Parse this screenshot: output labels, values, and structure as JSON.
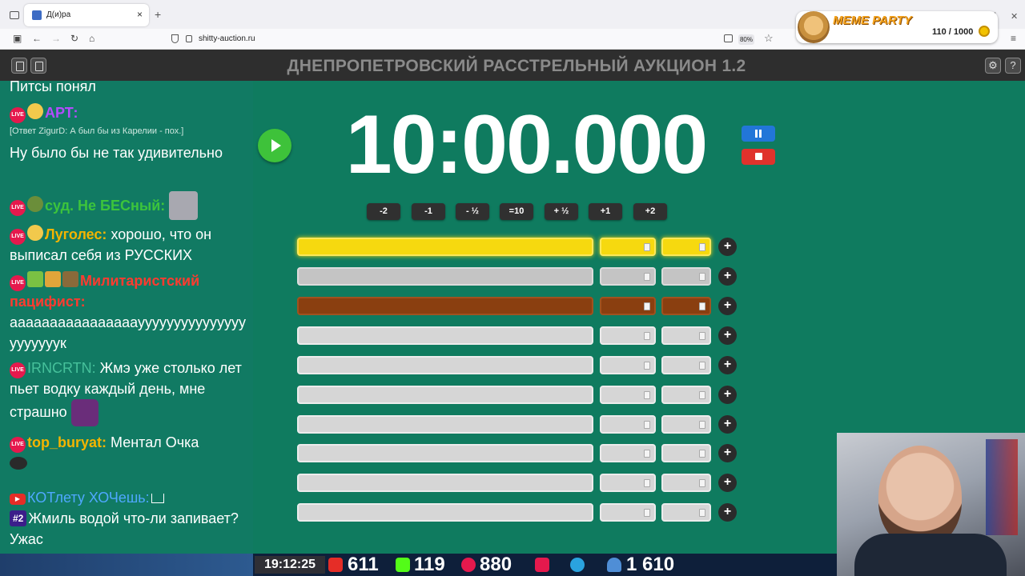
{
  "browser": {
    "tab_title": "Д(и)ра",
    "new_tab": "+",
    "tab_close": "×",
    "url": "shitty-auction.ru",
    "zoom": "80%"
  },
  "meme_party": {
    "title": "MEME PARTY",
    "score": "110 / 1000"
  },
  "app": {
    "title": "ДНЕПРОПЕТРОВСКИЙ РАССТРЕЛЬНЫЙ АУКЦИОН 1.2"
  },
  "chat": {
    "top_text": "Питсы понял",
    "messages": [
      {
        "user": "АРТ:",
        "user_color": "#b44cff",
        "reply": "[Ответ ZigurD: А был бы из Карелии - пох.]",
        "text": "Ну было бы не так удивительно"
      },
      {
        "user": "суд. Не БЕСный:",
        "user_color": "#3cc43c",
        "text": ""
      },
      {
        "user": "Луголес:",
        "user_color": "#f4b400",
        "text": " хорошо, что он выписал себя из РУССКИХ"
      },
      {
        "user": "Милитаристский пацифист:",
        "user_color": "#ff3b2f",
        "text": "аааааааааааааааауууууууууууууууууууууук"
      },
      {
        "user": "IRNCRTN:",
        "user_color": "#46c19b",
        "text": " Жмэ уже столько лет пьет водку каждый день, мне страшно"
      },
      {
        "user": "top_buryat:",
        "user_color": "#f4b400",
        "text": " Ментал Очка"
      },
      {
        "user": "КОТлету ХОЧешь:",
        "user_color": "#4fa8ff",
        "rank": "#2",
        "text": "Жмиль водой что-ли запивает? Ужас"
      }
    ],
    "live_label": "LIVE"
  },
  "timer": {
    "value": "10:00.000"
  },
  "adjust_buttons": [
    "-2",
    "-1",
    "- ½",
    "=10",
    "+ ½",
    "+1",
    "+2"
  ],
  "lots": [
    {
      "tier": "gold"
    },
    {
      "tier": "silver"
    },
    {
      "tier": "bronze"
    },
    {
      "tier": "plain"
    },
    {
      "tier": "plain"
    },
    {
      "tier": "plain"
    },
    {
      "tier": "plain"
    },
    {
      "tier": "plain"
    },
    {
      "tier": "plain"
    },
    {
      "tier": "plain"
    }
  ],
  "lot_plus": "+",
  "statusbar": {
    "clock": "19:12:25",
    "youtube": "611",
    "kick": "119",
    "live": "880",
    "viewers": "1 610"
  },
  "colors": {
    "main_bg": "#0f7b5f",
    "gold": "#f6d90f",
    "silver": "#c4c4c4",
    "bronze": "#8a3f10",
    "play": "#3ec23a",
    "pause": "#2276d8",
    "stop": "#e0322c"
  }
}
